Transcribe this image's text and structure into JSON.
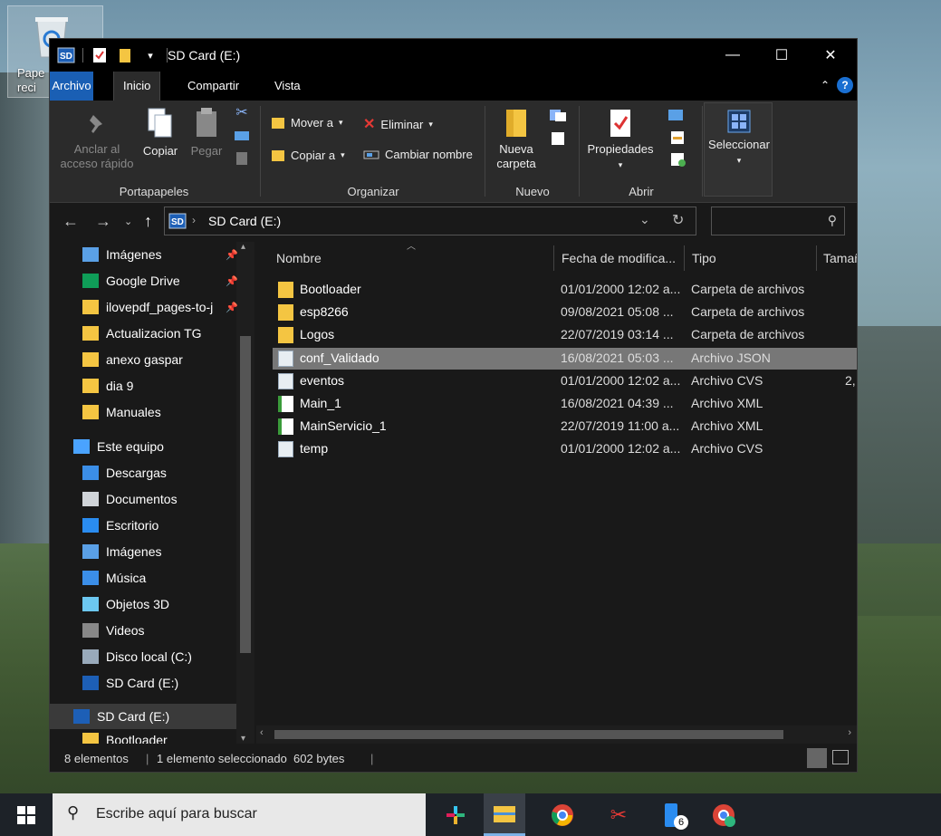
{
  "desktop": {
    "recycle_label_1": "Pape",
    "recycle_label_2": "reci"
  },
  "window": {
    "title": "SD Card (E:)",
    "controls": {
      "minimize": "—",
      "maximize": "☐",
      "close": "✕"
    }
  },
  "ribbon_tabs": [
    "Archivo",
    "Inicio",
    "Compartir",
    "Vista"
  ],
  "ribbon": {
    "portapapeles": {
      "label": "Portapapeles",
      "pin_line1": "Anclar al",
      "pin_line2": "acceso rápido",
      "copy": "Copiar",
      "paste": "Pegar"
    },
    "organizar": {
      "label": "Organizar",
      "move": "Mover a",
      "copy_to": "Copiar a",
      "delete": "Eliminar",
      "rename": "Cambiar nombre"
    },
    "nuevo": {
      "label": "Nuevo",
      "new_folder_1": "Nueva",
      "new_folder_2": "carpeta"
    },
    "abrir": {
      "label": "Abrir",
      "properties": "Propiedades"
    },
    "seleccionar": {
      "label": "Seleccionar"
    }
  },
  "address": {
    "path": "SD Card (E:)",
    "search_placeholder": ""
  },
  "sidebar": {
    "items": [
      {
        "label": "Imágenes",
        "icon": "pictures-icon",
        "pinned": true
      },
      {
        "label": "Google Drive",
        "icon": "google-drive-icon",
        "pinned": true
      },
      {
        "label": "ilovepdf_pages-to-j",
        "icon": "folder-icon",
        "pinned": true
      },
      {
        "label": "Actualizacion TG",
        "icon": "folder-icon",
        "pinned": false
      },
      {
        "label": "anexo gaspar",
        "icon": "folder-icon",
        "pinned": false
      },
      {
        "label": "dia 9",
        "icon": "folder-icon",
        "pinned": false
      },
      {
        "label": "Manuales",
        "icon": "folder-icon",
        "pinned": false
      },
      {
        "label": "Este equipo",
        "icon": "computer-icon",
        "pinned": false
      },
      {
        "label": "Descargas",
        "icon": "downloads-icon",
        "pinned": false
      },
      {
        "label": "Documentos",
        "icon": "documents-icon",
        "pinned": false
      },
      {
        "label": "Escritorio",
        "icon": "desktop-icon",
        "pinned": false
      },
      {
        "label": "Imágenes",
        "icon": "pictures-icon",
        "pinned": false
      },
      {
        "label": "Música",
        "icon": "music-icon",
        "pinned": false
      },
      {
        "label": "Objetos 3D",
        "icon": "3d-objects-icon",
        "pinned": false
      },
      {
        "label": "Videos",
        "icon": "videos-icon",
        "pinned": false
      },
      {
        "label": "Disco local (C:)",
        "icon": "drive-icon",
        "pinned": false
      },
      {
        "label": "SD Card (E:)",
        "icon": "sd-card-icon",
        "pinned": false
      },
      {
        "label": "SD Card (E:)",
        "icon": "sd-card-icon",
        "pinned": false,
        "selected": true
      },
      {
        "label": "Bootloader",
        "icon": "folder-icon",
        "pinned": false
      }
    ]
  },
  "columns": [
    "Nombre",
    "Fecha de modifica...",
    "Tipo",
    "Tamañ"
  ],
  "files": [
    {
      "name": "Bootloader",
      "date": "01/01/2000 12:02 a...",
      "type": "Carpeta de archivos",
      "size": "",
      "icon": "folder-icon"
    },
    {
      "name": "esp8266",
      "date": "09/08/2021 05:08 ...",
      "type": "Carpeta de archivos",
      "size": "",
      "icon": "folder-icon"
    },
    {
      "name": "Logos",
      "date": "22/07/2019 03:14 ...",
      "type": "Carpeta de archivos",
      "size": "",
      "icon": "folder-icon"
    },
    {
      "name": "conf_Validado",
      "date": "16/08/2021 05:03 ...",
      "type": "Archivo JSON",
      "size": "",
      "icon": "file-icon",
      "selected": true
    },
    {
      "name": "eventos",
      "date": "01/01/2000 12:02 a...",
      "type": "Archivo CVS",
      "size": "2,",
      "icon": "file-icon"
    },
    {
      "name": "Main_1",
      "date": "16/08/2021 04:39 ...",
      "type": "Archivo XML",
      "size": "",
      "icon": "xml-file-icon"
    },
    {
      "name": "MainServicio_1",
      "date": "22/07/2019 11:00 a...",
      "type": "Archivo XML",
      "size": "",
      "icon": "xml-file-icon"
    },
    {
      "name": "temp",
      "date": "01/01/2000 12:02 a...",
      "type": "Archivo CVS",
      "size": "",
      "icon": "file-icon"
    }
  ],
  "status": {
    "count": "8 elementos",
    "selection": "1 elemento seleccionado  602 bytes"
  },
  "taskbar": {
    "search_placeholder": "Escribe aquí para buscar",
    "badge": "6"
  },
  "colors": {
    "accent": "#1a5fb4",
    "folder": "#f4c542",
    "selected_row": "#777777"
  }
}
